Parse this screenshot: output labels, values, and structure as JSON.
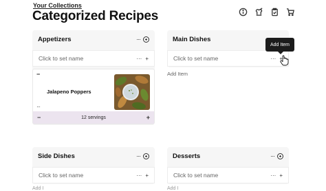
{
  "breadcrumb": "Your Collections",
  "page_title": "Categorized Recipes",
  "top_icons": [
    "info-icon",
    "chef-hat-icon",
    "clipboard-icon",
    "cart-icon"
  ],
  "categories": [
    {
      "title": "Appetizers",
      "name_placeholder": "Click to set name",
      "actions": "···",
      "name_actions": "···"
    },
    {
      "title": "Main Dishes",
      "name_placeholder": "Click to set name",
      "actions": "···",
      "name_actions": "···",
      "add_item": "Add Item"
    },
    {
      "title": "Side Dishes",
      "name_placeholder": "Click to set name",
      "actions": "···",
      "name_actions": "···"
    },
    {
      "title": "Desserts",
      "name_placeholder": "Click to set name",
      "actions": "···",
      "name_actions": "···"
    }
  ],
  "recipe": {
    "name": "Jalapeno Poppers",
    "servings": "12 servings",
    "minus": "−",
    "plus": "+",
    "top_minus": "−",
    "menu": "···"
  },
  "tooltip": "Add Item",
  "bottom_stubs": [
    "Add I",
    "Add I"
  ]
}
